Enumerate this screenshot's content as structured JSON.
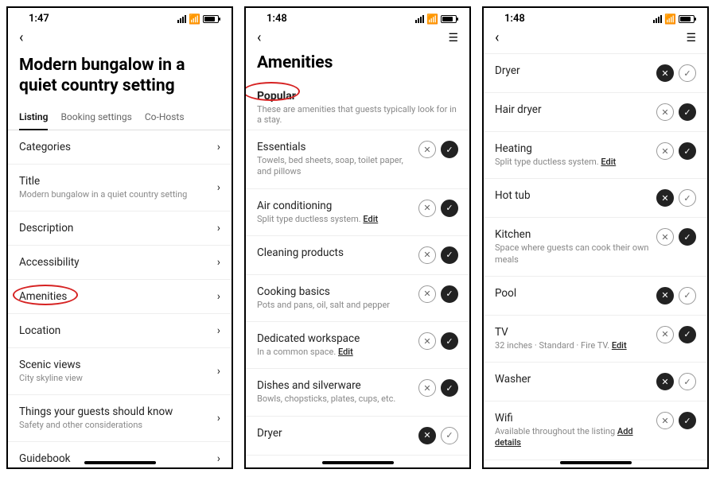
{
  "screens": [
    {
      "time": "1:47",
      "title": "Modern bungalow in a quiet country setting",
      "tabs": [
        "Listing",
        "Booking settings",
        "Co-Hosts"
      ],
      "activeTab": 0,
      "rows": [
        {
          "label": "Categories"
        },
        {
          "label": "Title",
          "sub": "Modern bungalow in a quiet country setting"
        },
        {
          "label": "Description"
        },
        {
          "label": "Accessibility"
        },
        {
          "label": "Amenities",
          "circled": true
        },
        {
          "label": "Location"
        },
        {
          "label": "Scenic views",
          "sub": "City skyline view"
        },
        {
          "label": "Things your guests should know",
          "sub": "Safety and other considerations"
        },
        {
          "label": "Guidebook"
        }
      ]
    },
    {
      "time": "1:48",
      "title": "Amenities",
      "section": {
        "title": "Popular",
        "sub": "These are amenities that guests typically look for in a stay.",
        "circled": true
      },
      "items": [
        {
          "label": "Essentials",
          "sub": "Towels, bed sheets, soap, toilet paper, and pillows",
          "x": "off",
          "check": "on"
        },
        {
          "label": "Air conditioning",
          "sub": "Split type ductless system.",
          "edit": "Edit",
          "x": "off",
          "check": "on"
        },
        {
          "label": "Cleaning products",
          "x": "off",
          "check": "on"
        },
        {
          "label": "Cooking basics",
          "sub": "Pots and pans, oil, salt and pepper",
          "x": "off",
          "check": "on"
        },
        {
          "label": "Dedicated workspace",
          "sub": "In a common space.",
          "edit": "Edit",
          "x": "off",
          "check": "on"
        },
        {
          "label": "Dishes and silverware",
          "sub": "Bowls, chopsticks, plates, cups, etc.",
          "x": "off",
          "check": "on"
        },
        {
          "label": "Dryer",
          "x": "on",
          "check": "off"
        }
      ]
    },
    {
      "time": "1:48",
      "items": [
        {
          "label": "Dryer",
          "x": "on",
          "check": "off"
        },
        {
          "label": "Hair dryer",
          "x": "off",
          "check": "on"
        },
        {
          "label": "Heating",
          "sub": "Split type ductless system.",
          "edit": "Edit",
          "x": "off",
          "check": "on"
        },
        {
          "label": "Hot tub",
          "x": "on",
          "check": "off"
        },
        {
          "label": "Kitchen",
          "sub": "Space where guests can cook their own meals",
          "x": "off",
          "check": "on"
        },
        {
          "label": "Pool",
          "x": "on",
          "check": "off"
        },
        {
          "label": "TV",
          "sub": "32 inches · Standard · Fire TV.",
          "edit": "Edit",
          "x": "off",
          "check": "on"
        },
        {
          "label": "Washer",
          "x": "on",
          "check": "off"
        },
        {
          "label": "Wifi",
          "sub": "Available throughout the listing",
          "add": "Add details",
          "x": "off",
          "check": "on"
        }
      ]
    }
  ]
}
